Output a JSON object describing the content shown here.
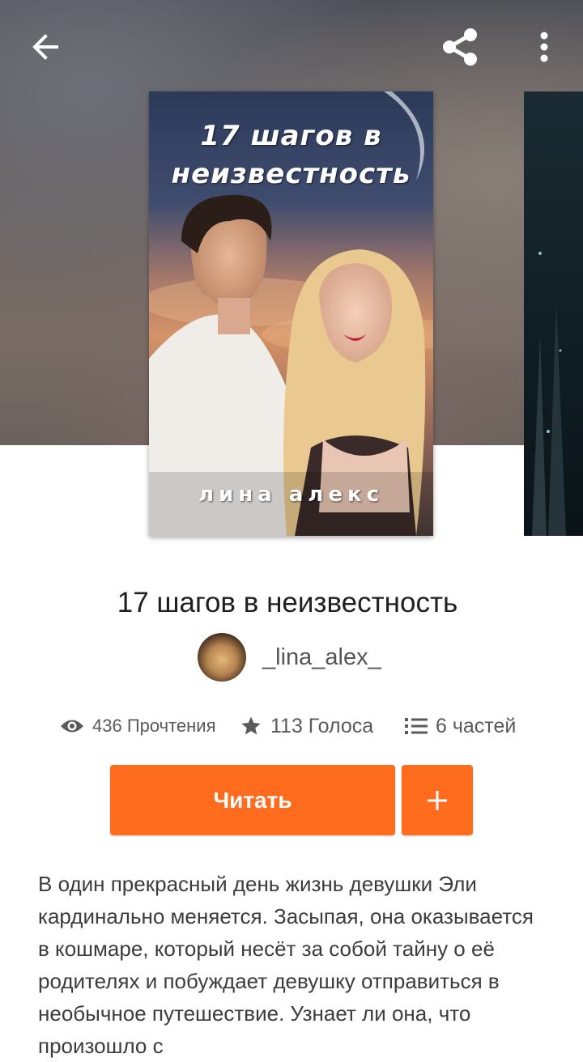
{
  "topbar": {
    "back_icon": "arrow-left-icon",
    "share_icon": "share-icon",
    "more_icon": "more-vertical-icon"
  },
  "cover": {
    "title_line1": "17 шагов в",
    "title_line2": "неизвестность",
    "author_text": "лина алекс"
  },
  "story": {
    "title": "17 шагов в неизвестность",
    "author": "_lina_alex_"
  },
  "stats": {
    "reads": "436 Прочтения",
    "votes": "113 Голоса",
    "parts": "6 частей"
  },
  "actions": {
    "read_label": "Читать",
    "add_icon": "plus-icon"
  },
  "description": "В один прекрасный день жизнь девушки Эли кардинально меняется. Засыпая, она оказывается в кошмаре, который несёт за собой тайну о её родителях и побуждает девушку отправиться в необычное путешествие. Узнает ли она, что произошло с",
  "colors": {
    "accent": "#ff6c1e",
    "text_primary": "#1f1f1f",
    "text_secondary": "#5a5a5a"
  }
}
